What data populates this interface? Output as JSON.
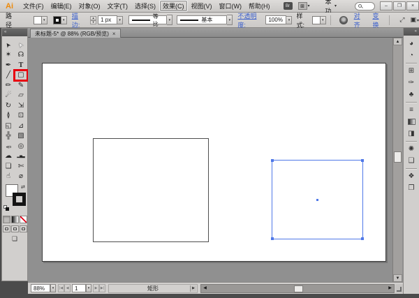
{
  "app_bar": {
    "logo": "Ai",
    "menus": [
      "文件(F)",
      "编辑(E)",
      "对象(O)",
      "文字(T)",
      "选择(S)",
      "效果(C)",
      "视图(V)",
      "窗口(W)",
      "帮助(H)"
    ],
    "highlighted_menu": "效果(C)",
    "bridge_icon_label": "Br",
    "arrange_icon_glyph": "⊞",
    "workspace": "基本功能",
    "search_value": "",
    "window": {
      "minimize": "–",
      "restore": "❐",
      "close": "×"
    }
  },
  "control_bar": {
    "selection_type": "路径",
    "stroke_label": "描边:",
    "stroke_weight": "1 px",
    "stroke_profile": "等比",
    "brush_definition": "基本",
    "opacity_label": "不透明度:",
    "opacity_value": "100%",
    "style_label": "样式:",
    "align": "对齐",
    "transform": "变换"
  },
  "toolbox": {
    "highlighted_tool": "rectangle-tool",
    "tools": [
      {
        "name": "selection-tool",
        "glyph": "➤"
      },
      {
        "name": "direct-selection-tool",
        "glyph": "➤"
      },
      {
        "name": "magic-wand-tool",
        "glyph": "✶"
      },
      {
        "name": "lasso-tool",
        "glyph": "☊"
      },
      {
        "name": "pen-tool",
        "glyph": "✒"
      },
      {
        "name": "type-tool",
        "glyph": "T"
      },
      {
        "name": "line-segment-tool",
        "glyph": "╱"
      },
      {
        "name": "rectangle-tool",
        "glyph": "▢"
      },
      {
        "name": "paintbrush-tool",
        "glyph": "✏"
      },
      {
        "name": "pencil-tool",
        "glyph": "✎"
      },
      {
        "name": "blob-brush-tool",
        "glyph": "☄"
      },
      {
        "name": "eraser-tool",
        "glyph": "▱"
      },
      {
        "name": "rotate-tool",
        "glyph": "↻"
      },
      {
        "name": "scale-tool",
        "glyph": "⇲"
      },
      {
        "name": "width-tool",
        "glyph": "≬"
      },
      {
        "name": "free-transform-tool",
        "glyph": "⊡"
      },
      {
        "name": "shape-builder-tool",
        "glyph": "◱"
      },
      {
        "name": "perspective-grid-tool",
        "glyph": "⊿"
      },
      {
        "name": "mesh-tool",
        "glyph": "╬"
      },
      {
        "name": "gradient-tool",
        "glyph": "▧"
      },
      {
        "name": "eyedropper-tool",
        "glyph": "✑"
      },
      {
        "name": "blend-tool",
        "glyph": "◎"
      },
      {
        "name": "symbol-sprayer-tool",
        "glyph": "☁"
      },
      {
        "name": "column-graph-tool",
        "glyph": "▂▅▃"
      },
      {
        "name": "artboard-tool",
        "glyph": "❏"
      },
      {
        "name": "slice-tool",
        "glyph": "✄"
      },
      {
        "name": "hand-tool",
        "glyph": "☝"
      },
      {
        "name": "zoom-tool",
        "glyph": "⌀"
      }
    ]
  },
  "document": {
    "tab_title": "未标题-5* @ 88% (RGB/预览)",
    "tab_close": "×",
    "zoom_level": "88%",
    "artboard_number": "1",
    "status_tool": "矩形"
  },
  "dock": {
    "panels": [
      {
        "name": "color",
        "glyph": "◕"
      },
      {
        "name": "color-guide",
        "glyph": "◔"
      },
      {
        "name": "swatches",
        "glyph": "⊞"
      },
      {
        "name": "brushes",
        "glyph": "✑"
      },
      {
        "name": "symbols",
        "glyph": "♣"
      },
      {
        "name": "stroke",
        "glyph": "≡"
      },
      {
        "name": "gradient",
        "glyph": ""
      },
      {
        "name": "transparency",
        "glyph": "◨"
      },
      {
        "name": "appearance",
        "glyph": "✺"
      },
      {
        "name": "graphic-styles",
        "glyph": "❑"
      },
      {
        "name": "layers",
        "glyph": "❖"
      },
      {
        "name": "artboards",
        "glyph": "❐"
      }
    ]
  },
  "colors": {
    "selection_blue": "#4f78e8",
    "annotation_red": "#e8000d",
    "link_blue": "#3a5fcd",
    "logo_orange": "#ee8a0a",
    "canvas_gray": "#909090"
  }
}
